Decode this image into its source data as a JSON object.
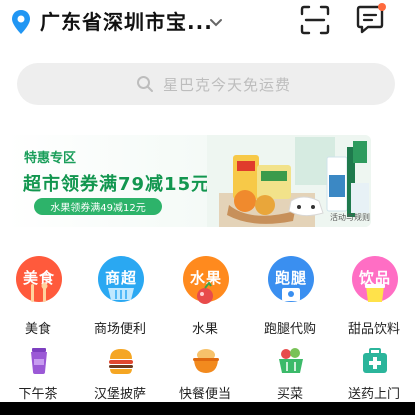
{
  "header": {
    "location": "广东省深圳市宝...",
    "location_icon": "location-pin-icon",
    "dropdown_icon": "chevron-down-icon",
    "scan_icon": "scan-icon",
    "message_icon": "message-icon",
    "has_notification": true,
    "notification_color": "#ff6a3d",
    "accent_color": "#2196f3"
  },
  "search": {
    "placeholder": "星巴克今天免运费",
    "icon": "search-icon"
  },
  "banner": {
    "tag": "特惠专区",
    "title": "超市领券满79减15元",
    "subtitle": "水果领券满49减12元",
    "rule": "活动与规则",
    "accent_color": "#12964f"
  },
  "categories_primary": [
    {
      "circle_text": "美食",
      "label": "美食",
      "color": "#ff5a3c",
      "icon": "fork-spoon-icon"
    },
    {
      "circle_text": "商超",
      "label": "商场便利",
      "color": "#2aa8f2",
      "icon": "basket-icon"
    },
    {
      "circle_text": "水果",
      "label": "水果",
      "color": "#ff8a1e",
      "icon": "lychee-icon"
    },
    {
      "circle_text": "跑腿",
      "label": "跑腿代购",
      "color": "#3a8ff0",
      "icon": "courier-icon"
    },
    {
      "circle_text": "饮品",
      "label": "甜品饮料",
      "color": "#ff6ec4",
      "icon": "drink-icon"
    }
  ],
  "categories_secondary": [
    {
      "label": "下午茶",
      "icon": "cup-icon",
      "color": "#9b59d6"
    },
    {
      "label": "汉堡披萨",
      "icon": "burger-icon",
      "color": "#f5a623"
    },
    {
      "label": "快餐便当",
      "icon": "bento-icon",
      "color": "#f28a1e"
    },
    {
      "label": "买菜",
      "icon": "vegetable-basket-icon",
      "color": "#3cba6a"
    },
    {
      "label": "送药上门",
      "icon": "medicine-box-icon",
      "color": "#2bb59b"
    }
  ]
}
